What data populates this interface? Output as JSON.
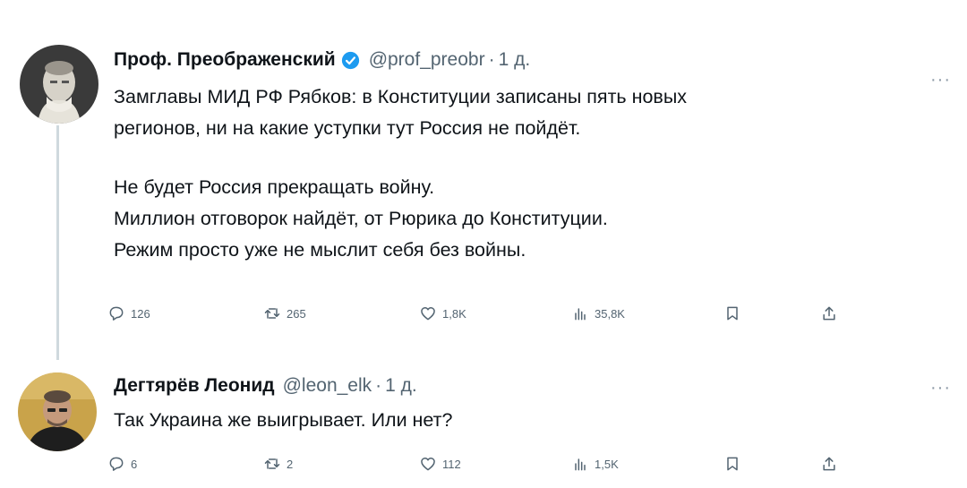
{
  "tweets": [
    {
      "author_name": "Проф. Преображенский",
      "verified": true,
      "handle": "@prof_preobr",
      "dot": "·",
      "time": "1 д.",
      "more": "···",
      "text_paragraphs": [
        "Замглавы МИД РФ Рябков: в Конституции записаны пять новых",
        "регионов, ни на какие уступки тут Россия не пойдёт.",
        "",
        "Не будет Россия прекращать войну.",
        "Миллион отговорок найдёт, от Рюрика до Конституции.",
        "Режим просто уже не мыслит себя без войны."
      ],
      "stats": {
        "replies": "126",
        "reposts": "265",
        "likes": "1,8K",
        "views": "35,8K"
      }
    },
    {
      "author_name": "Дегтярёв Леонид",
      "verified": false,
      "handle": "@leon_elk",
      "dot": "·",
      "time": "1 д.",
      "more": "···",
      "text_paragraphs": [
        "Так Украина же выигрывает. Или нет?"
      ],
      "stats": {
        "replies": "6",
        "reposts": "2",
        "likes": "112",
        "views": "1,5K"
      }
    }
  ],
  "icons": {
    "reply": "reply-icon",
    "repost": "repost-icon",
    "like": "heart-icon",
    "views": "views-bar-chart-icon",
    "bookmark": "bookmark-icon",
    "share": "share-icon",
    "verified": "verified-badge-icon"
  },
  "colors": {
    "verified_blue": "#1d9bf0",
    "secondary_text": "#536471",
    "thread_line": "#cfd9de"
  }
}
